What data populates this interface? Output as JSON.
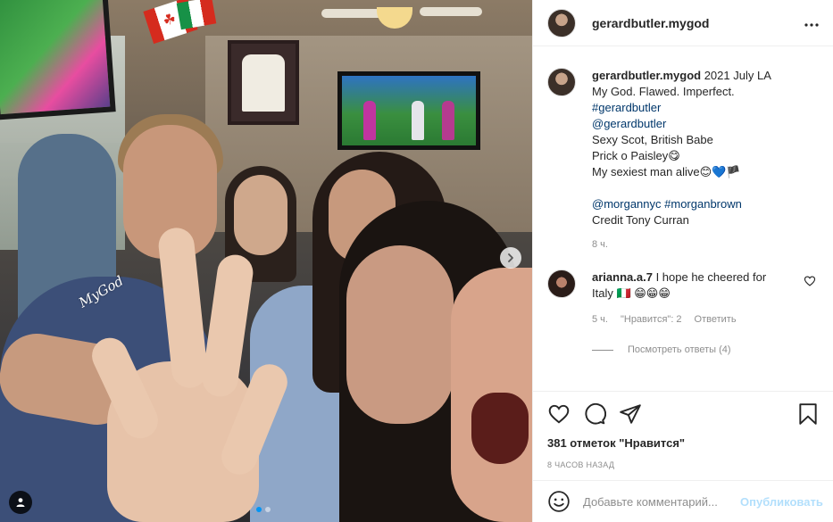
{
  "post": {
    "author": "gerardbutler.mygod",
    "header_more": "•••",
    "watermark": "MyGod"
  },
  "caption": {
    "author": "gerardbutler.mygod",
    "line1": "2021 July LA",
    "line2": "My God. Flawed. Imperfect.",
    "hashtag1": "#gerardbutler",
    "mention1": "@gerardbutler",
    "line3": "Sexy Scot, British Babe",
    "line4": "Prick o Paisley😋",
    "line5": "My sexiest man alive😊💙🏴",
    "mention2": "@morgannyc",
    "hashtag2": "#morganbrown",
    "credit": "Credit Tony Curran",
    "time": "8 ч."
  },
  "comment": {
    "author": "arianna.a.7",
    "text": "I hope he cheered for Italy 🇮🇹 😁😁😁",
    "time": "5 ч.",
    "likes": "\"Нравится\": 2",
    "reply": "Ответить",
    "view_replies": "Посмотреть ответы (4)"
  },
  "stats": {
    "likes": "381 отметок \"Нравится\"",
    "posted": "8 ЧАСОВ НАЗАД"
  },
  "composer": {
    "placeholder": "Добавьте комментарий...",
    "post_label": "Опубликовать"
  },
  "colors": {
    "link": "#00376b",
    "muted": "#8e8e8e",
    "active_dot": "#0095f6",
    "post_disabled": "#b2dffc"
  },
  "icons": [
    "tag-user-icon",
    "chevron-right-icon",
    "more-icon",
    "heart-icon",
    "comment-icon",
    "share-icon",
    "bookmark-icon",
    "emoji-icon"
  ],
  "carousel": {
    "current": 1,
    "total": 2
  }
}
